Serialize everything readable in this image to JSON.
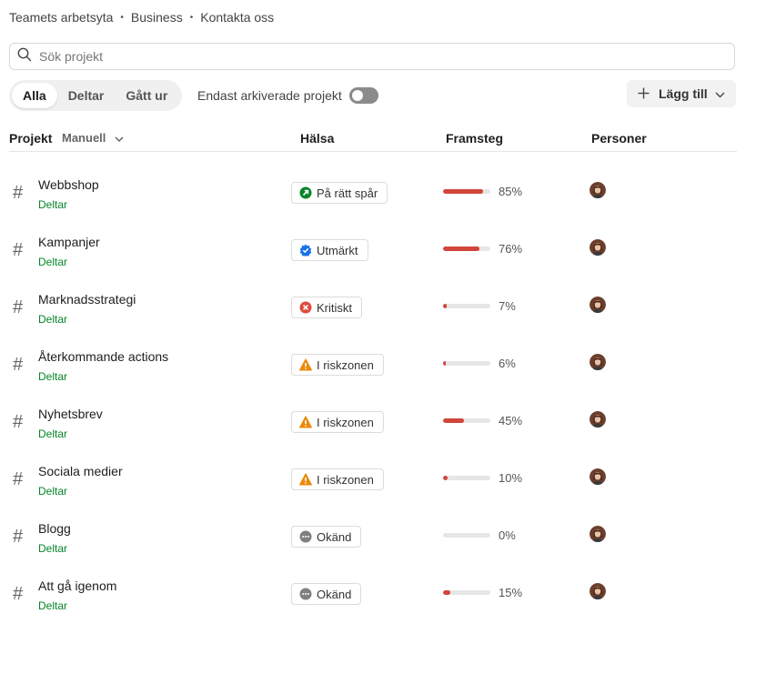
{
  "breadcrumb": [
    "Teamets arbetsyta",
    "Business",
    "Kontakta oss"
  ],
  "search": {
    "placeholder": "Sök projekt"
  },
  "filter_tabs": [
    "Alla",
    "Deltar",
    "Gått ur"
  ],
  "active_tab": "Alla",
  "archived_toggle": {
    "label": "Endast arkiverade projekt",
    "on": false
  },
  "add_button": {
    "label": "Lägg till"
  },
  "columns": {
    "project": "Projekt",
    "sort": "Manuell",
    "health": "Hälsa",
    "progress": "Framsteg",
    "people": "Personer"
  },
  "health_colors": {
    "on-track": "#058527",
    "excellent": "#1a73e8",
    "critical": "#dc4c3e",
    "at-risk": "#eb8909",
    "unknown": "#808080"
  },
  "progress_color": "#d1453b",
  "projects": [
    {
      "name": "Webbshop",
      "status": "Deltar",
      "health": "På rätt spår",
      "health_type": "on-track",
      "progress": 85,
      "progress_label": "85%"
    },
    {
      "name": "Kampanjer",
      "status": "Deltar",
      "health": "Utmärkt",
      "health_type": "excellent",
      "progress": 76,
      "progress_label": "76%"
    },
    {
      "name": "Marknadsstrategi",
      "status": "Deltar",
      "health": "Kritiskt",
      "health_type": "critical",
      "progress": 7,
      "progress_label": "7%"
    },
    {
      "name": "Återkommande actions",
      "status": "Deltar",
      "health": "I riskzonen",
      "health_type": "at-risk",
      "progress": 6,
      "progress_label": "6%"
    },
    {
      "name": "Nyhetsbrev",
      "status": "Deltar",
      "health": "I riskzonen",
      "health_type": "at-risk",
      "progress": 45,
      "progress_label": "45%"
    },
    {
      "name": "Sociala medier",
      "status": "Deltar",
      "health": "I riskzonen",
      "health_type": "at-risk",
      "progress": 10,
      "progress_label": "10%"
    },
    {
      "name": "Blogg",
      "status": "Deltar",
      "health": "Okänd",
      "health_type": "unknown",
      "progress": 0,
      "progress_label": "0%"
    },
    {
      "name": "Att gå igenom",
      "status": "Deltar",
      "health": "Okänd",
      "health_type": "unknown",
      "progress": 15,
      "progress_label": "15%"
    }
  ]
}
